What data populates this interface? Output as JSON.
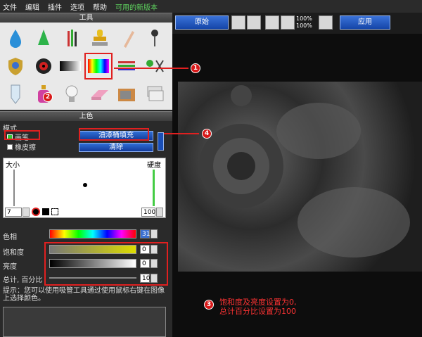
{
  "menu": {
    "file": "文件",
    "edit": "编辑",
    "plugin": "插件",
    "options": "选项",
    "help": "帮助",
    "new_version": "可用的新版本"
  },
  "tools_panel": {
    "title": "工具"
  },
  "color_panel": {
    "title": "上色",
    "mode_label": "模式",
    "brush_label": "画笔",
    "eraser_label": "橡皮擦",
    "fill_button": "油漆桶填充",
    "clear_button": "清除",
    "size_label": "大小",
    "hardness_label": "硬度",
    "size_value": "7",
    "hardness_value": "100",
    "hue_label": "色相",
    "hue_value": "31",
    "saturation_label": "饱和度",
    "saturation_value": "0",
    "brightness_label": "亮度",
    "brightness_value": "0",
    "total_label": "总计, 百分比",
    "total_value": "100",
    "hint": "提示：您可以使用吸管工具通过使用鼠标右键在图像上选择颜色。"
  },
  "toolbar": {
    "original": "原始",
    "apply": "应用",
    "zoom_top": "100%",
    "zoom_bottom": "100%"
  },
  "annotations": {
    "n1": "1",
    "n2": "2",
    "n3": "3",
    "n4": "4",
    "note_line1": "饱和度及亮度设置为0,",
    "note_line2": "总计百分比设置为100"
  },
  "colors": {
    "accent_red": "#e02020",
    "button_blue": "#1a4fb8"
  }
}
